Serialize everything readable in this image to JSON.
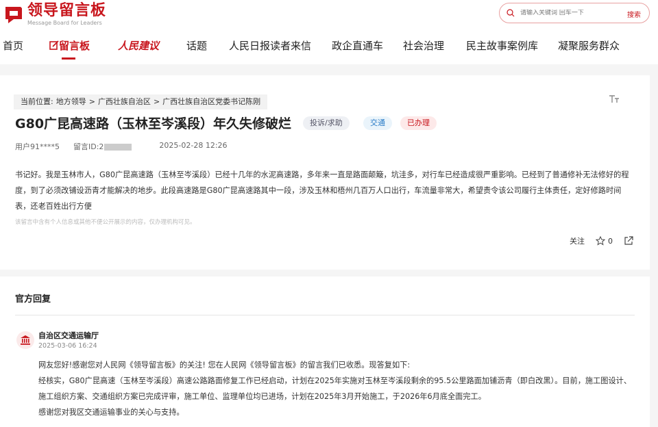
{
  "logo": {
    "cn": "领导留言板",
    "en": "Message Board for Leaders"
  },
  "search": {
    "placeholder": "请输入关键词 回车一下",
    "button": "搜索"
  },
  "nav": {
    "items": [
      {
        "label": "首页"
      },
      {
        "label": "留言板"
      },
      {
        "label": "人民建议"
      },
      {
        "label": "话题"
      },
      {
        "label": "人民日报读者来信"
      },
      {
        "label": "政企直通车"
      },
      {
        "label": "社会治理"
      },
      {
        "label": "民主故事案例库"
      },
      {
        "label": "凝聚服务群众"
      }
    ]
  },
  "breadcrumb": {
    "prefix": "当前位置:",
    "items": [
      "地方领导",
      ">",
      "广西壮族自治区",
      ">",
      "广西壮族自治区党委书记陈刚"
    ]
  },
  "message": {
    "title": "G80广昆高速路（玉林至岑溪段）年久失修破烂",
    "tags": {
      "type": "投诉/求助",
      "field": "交通",
      "status": "已办理"
    },
    "user": "用户91****5",
    "id_label": "留言ID:2",
    "datetime": "2025-02-28 12:26",
    "body": "书记好。我是玉林市人，G80广昆高速路（玉林至岑溪段）已经十几年的水泥高速路，多年来一直是路面颠簸，坑洼多，对行车已经造成很严重影响。已经到了普通修补无法修好的程度，到了必须改铺设沥青才能解决的地步。此段高速路是G80广昆高速路其中一段，涉及玉林和梧州几百万人口出行，车流量非常大，希望责令该公司履行主体责任，定好修路时间表，还老百姓出行方便",
    "notice": "该留言中含有个人信息或其他不便公开展示的内容，仅办理机构可见。",
    "follow_label": "关注",
    "star_count": "0"
  },
  "reply": {
    "heading": "官方回复",
    "department": "自治区交通运输厅",
    "datetime": "2025-03-06 16:24",
    "paragraphs": [
      "网友您好!感谢您对人民网《领导留言板》的关注! 您在人民网《领导留言板》的留言我们已收悉。现答复如下:",
      "经核实，G80广昆高速（玉林至岑溪段）高速公路路面修复工作已经启动，计划在2025年实施对玉林至岑溪段剩余的95.5公里路面加铺沥青（即白改黑）。目前，施工图设计、施工组织方案、交通组织方案已完成评审，施工单位、监理单位均已进场，计划在2025年3月开始施工，于2026年6月底全面完工。",
      "感谢您对我区交通运输事业的关心与支持。"
    ]
  },
  "colors": {
    "brand": "#c8161d",
    "tag_field": "#2b7cc7"
  }
}
